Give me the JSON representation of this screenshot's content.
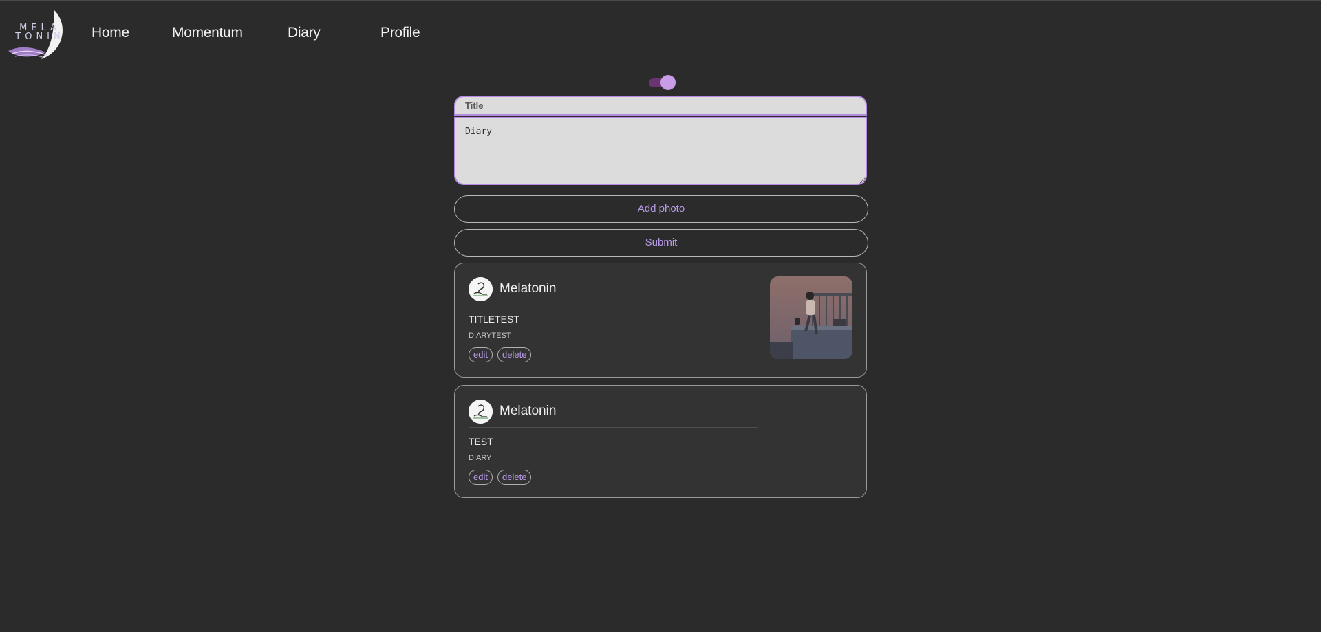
{
  "brand": {
    "logo_text": "MELA TONIN",
    "accent": "#b48be0",
    "background": "#2b2b2b"
  },
  "nav": {
    "items": [
      {
        "label": "Home"
      },
      {
        "label": "Momentum"
      },
      {
        "label": "Diary"
      },
      {
        "label": "Profile"
      }
    ]
  },
  "theme_toggle": {
    "state": "on",
    "icon": "toggle-switch"
  },
  "form": {
    "title_placeholder": "Title",
    "body_value": "Diary",
    "add_photo_label": "Add photo",
    "submit_label": "Submit"
  },
  "posts": [
    {
      "username": "Melatonin",
      "title": "TITLETEST",
      "body": "DIARYTEST",
      "edit_label": "edit",
      "delete_label": "delete",
      "has_image": true,
      "image_icon": "illustration-girl-on-balcony"
    },
    {
      "username": "Melatonin",
      "title": "TEST",
      "body": "DIARY",
      "edit_label": "edit",
      "delete_label": "delete",
      "has_image": false
    }
  ]
}
